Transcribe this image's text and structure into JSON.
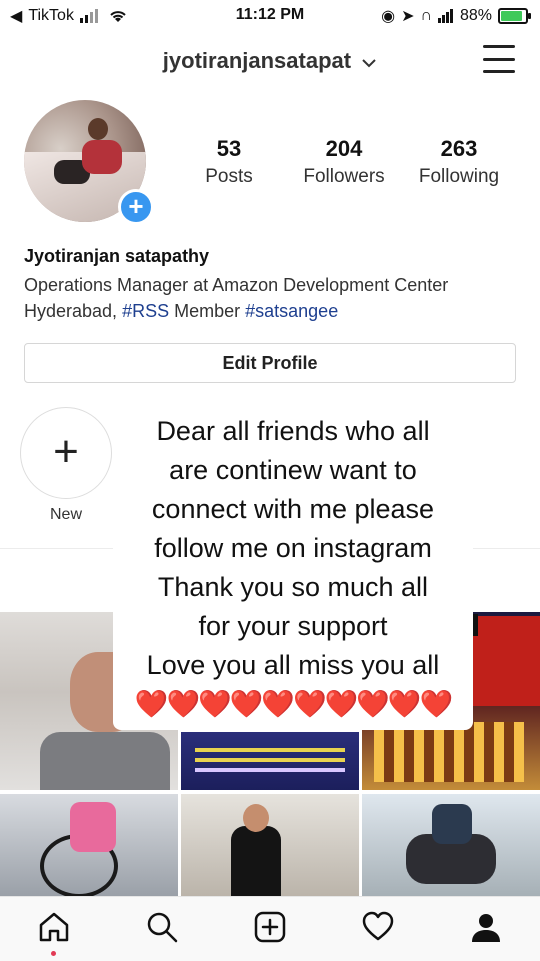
{
  "status_bar": {
    "back_app": "TikTok",
    "time": "11:12 PM",
    "battery": "88%"
  },
  "header": {
    "username": "jyotiranjansatapat",
    "dropdown_icon": "chevron-down-icon",
    "menu_icon": "hamburger-menu-icon"
  },
  "profile": {
    "stats": [
      {
        "value": "53",
        "label": "Posts"
      },
      {
        "value": "204",
        "label": "Followers"
      },
      {
        "value": "263",
        "label": "Following"
      }
    ],
    "full_name": "Jyotiranjan satapathy",
    "bio_line1": "Operations Manager at Amazon Development Center",
    "bio_line2_prefix": "Hyderabad, ",
    "bio_tag1": "#RSS",
    "bio_mid": " Member ",
    "bio_tag2": "#satsangee",
    "edit_button": "Edit Profile"
  },
  "highlights": {
    "new_symbol": "+",
    "new_label": "New"
  },
  "caption": {
    "lines": [
      "Dear all friends who all",
      "are continew want to",
      "connect with me please",
      "follow me on instagram",
      "Thank you so much all",
      "for your support",
      "Love you all miss you all"
    ],
    "hearts": "❤️❤️❤️❤️❤️❤️❤️❤️❤️❤️"
  },
  "bottom_nav": {
    "items": [
      "home-icon",
      "search-icon",
      "new-post-icon",
      "activity-heart-icon",
      "profile-icon"
    ]
  },
  "colors": {
    "accent_blue": "#3897f0",
    "hashtag": "#1e3f8f",
    "heart": "#e0181e"
  }
}
